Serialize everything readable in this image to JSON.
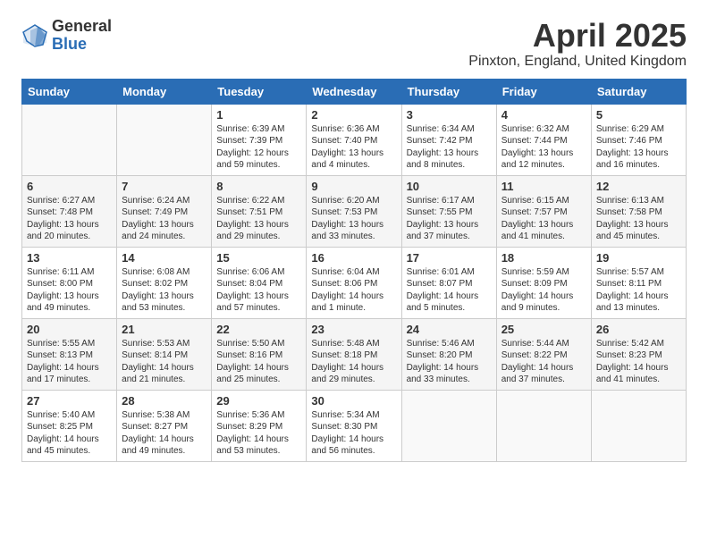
{
  "header": {
    "logo_general": "General",
    "logo_blue": "Blue",
    "month_title": "April 2025",
    "location": "Pinxton, England, United Kingdom"
  },
  "columns": [
    "Sunday",
    "Monday",
    "Tuesday",
    "Wednesday",
    "Thursday",
    "Friday",
    "Saturday"
  ],
  "weeks": [
    [
      {
        "day": "",
        "info": ""
      },
      {
        "day": "",
        "info": ""
      },
      {
        "day": "1",
        "info": "Sunrise: 6:39 AM\nSunset: 7:39 PM\nDaylight: 12 hours\nand 59 minutes."
      },
      {
        "day": "2",
        "info": "Sunrise: 6:36 AM\nSunset: 7:40 PM\nDaylight: 13 hours\nand 4 minutes."
      },
      {
        "day": "3",
        "info": "Sunrise: 6:34 AM\nSunset: 7:42 PM\nDaylight: 13 hours\nand 8 minutes."
      },
      {
        "day": "4",
        "info": "Sunrise: 6:32 AM\nSunset: 7:44 PM\nDaylight: 13 hours\nand 12 minutes."
      },
      {
        "day": "5",
        "info": "Sunrise: 6:29 AM\nSunset: 7:46 PM\nDaylight: 13 hours\nand 16 minutes."
      }
    ],
    [
      {
        "day": "6",
        "info": "Sunrise: 6:27 AM\nSunset: 7:48 PM\nDaylight: 13 hours\nand 20 minutes."
      },
      {
        "day": "7",
        "info": "Sunrise: 6:24 AM\nSunset: 7:49 PM\nDaylight: 13 hours\nand 24 minutes."
      },
      {
        "day": "8",
        "info": "Sunrise: 6:22 AM\nSunset: 7:51 PM\nDaylight: 13 hours\nand 29 minutes."
      },
      {
        "day": "9",
        "info": "Sunrise: 6:20 AM\nSunset: 7:53 PM\nDaylight: 13 hours\nand 33 minutes."
      },
      {
        "day": "10",
        "info": "Sunrise: 6:17 AM\nSunset: 7:55 PM\nDaylight: 13 hours\nand 37 minutes."
      },
      {
        "day": "11",
        "info": "Sunrise: 6:15 AM\nSunset: 7:57 PM\nDaylight: 13 hours\nand 41 minutes."
      },
      {
        "day": "12",
        "info": "Sunrise: 6:13 AM\nSunset: 7:58 PM\nDaylight: 13 hours\nand 45 minutes."
      }
    ],
    [
      {
        "day": "13",
        "info": "Sunrise: 6:11 AM\nSunset: 8:00 PM\nDaylight: 13 hours\nand 49 minutes."
      },
      {
        "day": "14",
        "info": "Sunrise: 6:08 AM\nSunset: 8:02 PM\nDaylight: 13 hours\nand 53 minutes."
      },
      {
        "day": "15",
        "info": "Sunrise: 6:06 AM\nSunset: 8:04 PM\nDaylight: 13 hours\nand 57 minutes."
      },
      {
        "day": "16",
        "info": "Sunrise: 6:04 AM\nSunset: 8:06 PM\nDaylight: 14 hours\nand 1 minute."
      },
      {
        "day": "17",
        "info": "Sunrise: 6:01 AM\nSunset: 8:07 PM\nDaylight: 14 hours\nand 5 minutes."
      },
      {
        "day": "18",
        "info": "Sunrise: 5:59 AM\nSunset: 8:09 PM\nDaylight: 14 hours\nand 9 minutes."
      },
      {
        "day": "19",
        "info": "Sunrise: 5:57 AM\nSunset: 8:11 PM\nDaylight: 14 hours\nand 13 minutes."
      }
    ],
    [
      {
        "day": "20",
        "info": "Sunrise: 5:55 AM\nSunset: 8:13 PM\nDaylight: 14 hours\nand 17 minutes."
      },
      {
        "day": "21",
        "info": "Sunrise: 5:53 AM\nSunset: 8:14 PM\nDaylight: 14 hours\nand 21 minutes."
      },
      {
        "day": "22",
        "info": "Sunrise: 5:50 AM\nSunset: 8:16 PM\nDaylight: 14 hours\nand 25 minutes."
      },
      {
        "day": "23",
        "info": "Sunrise: 5:48 AM\nSunset: 8:18 PM\nDaylight: 14 hours\nand 29 minutes."
      },
      {
        "day": "24",
        "info": "Sunrise: 5:46 AM\nSunset: 8:20 PM\nDaylight: 14 hours\nand 33 minutes."
      },
      {
        "day": "25",
        "info": "Sunrise: 5:44 AM\nSunset: 8:22 PM\nDaylight: 14 hours\nand 37 minutes."
      },
      {
        "day": "26",
        "info": "Sunrise: 5:42 AM\nSunset: 8:23 PM\nDaylight: 14 hours\nand 41 minutes."
      }
    ],
    [
      {
        "day": "27",
        "info": "Sunrise: 5:40 AM\nSunset: 8:25 PM\nDaylight: 14 hours\nand 45 minutes."
      },
      {
        "day": "28",
        "info": "Sunrise: 5:38 AM\nSunset: 8:27 PM\nDaylight: 14 hours\nand 49 minutes."
      },
      {
        "day": "29",
        "info": "Sunrise: 5:36 AM\nSunset: 8:29 PM\nDaylight: 14 hours\nand 53 minutes."
      },
      {
        "day": "30",
        "info": "Sunrise: 5:34 AM\nSunset: 8:30 PM\nDaylight: 14 hours\nand 56 minutes."
      },
      {
        "day": "",
        "info": ""
      },
      {
        "day": "",
        "info": ""
      },
      {
        "day": "",
        "info": ""
      }
    ]
  ]
}
